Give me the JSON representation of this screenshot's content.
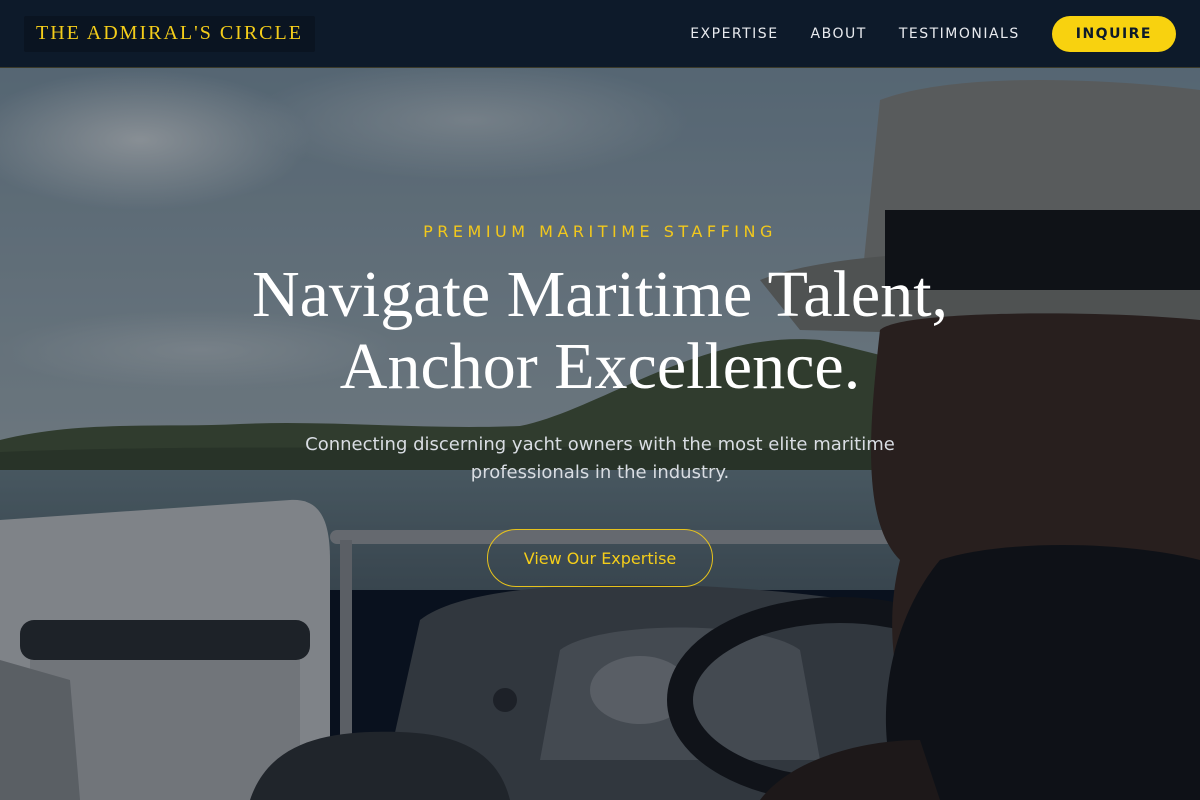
{
  "brand": {
    "logo_text": "THE ADMIRAL'S CIRCLE"
  },
  "nav": {
    "links": [
      {
        "label": "EXPERTISE"
      },
      {
        "label": "ABOUT"
      },
      {
        "label": "TESTIMONIALS"
      }
    ],
    "inquire_label": "INQUIRE"
  },
  "hero": {
    "eyebrow": "PREMIUM MARITIME STAFFING",
    "headline_line1": "Navigate Maritime Talent,",
    "headline_line2": "Anchor Excellence.",
    "subtext": "Connecting discerning yacht owners with the most elite maritime professionals in the industry.",
    "cta_label": "View Our Expertise",
    "background_image": "man-in-hat-steering-pontoon-boat"
  },
  "colors": {
    "accent": "#f8d20f",
    "navbar_bg": "#0d1a2a",
    "headline_text": "#ffffff"
  }
}
